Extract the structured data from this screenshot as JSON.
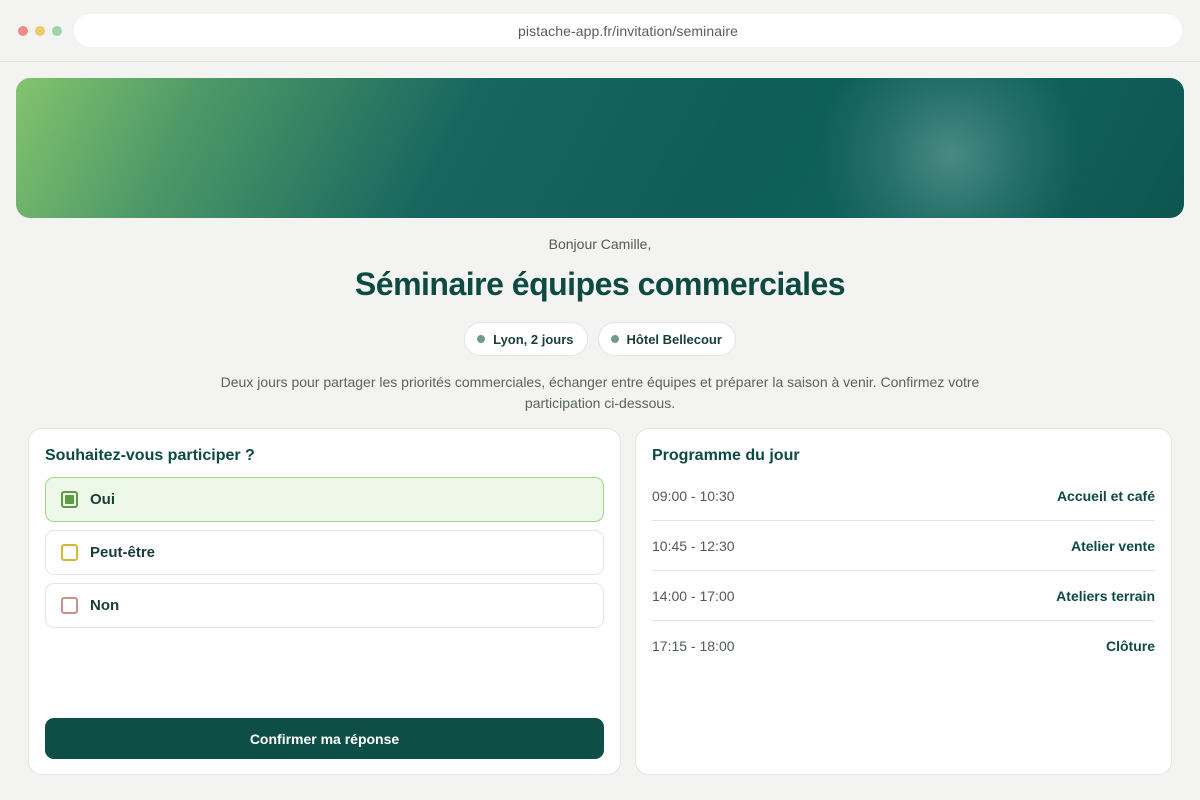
{
  "browser": {
    "url": "pistache-app.fr/invitation/seminaire",
    "dots": {
      "red": "#f08a8a",
      "yellow": "#eccb6b",
      "green": "#9fd4a8"
    }
  },
  "invitation": {
    "greeting": "Bonjour Camille,",
    "title": "Séminaire équipes commerciales",
    "chips": [
      {
        "label": "Lyon, 2 jours"
      },
      {
        "label": "Hôtel Bellecour"
      }
    ],
    "description": "Deux jours pour partager les priorités commerciales, échanger entre équipes et préparer la saison à venir. Confirmez votre participation ci-dessous."
  },
  "rsvp": {
    "heading": "Souhaitez-vous participer ?",
    "options": [
      {
        "label": "Oui",
        "selected": true,
        "color": "#5b9c45"
      },
      {
        "label": "Peut-être",
        "selected": false,
        "color": "#d9b53a"
      },
      {
        "label": "Non",
        "selected": false,
        "color": "#cf8f8f"
      }
    ],
    "confirm_label": "Confirmer ma réponse"
  },
  "program": {
    "heading": "Programme du jour",
    "items": [
      {
        "time": "09:00 - 10:30",
        "activity": "Accueil et café"
      },
      {
        "time": "10:45 - 12:30",
        "activity": "Atelier vente"
      },
      {
        "time": "14:00 - 17:00",
        "activity": "Ateliers terrain"
      },
      {
        "time": "17:15 - 18:00",
        "activity": "Clôture"
      }
    ]
  },
  "colors": {
    "primary": "#0d4f47",
    "background": "#f3f4f1",
    "selected_bg": "#eef8e8"
  }
}
